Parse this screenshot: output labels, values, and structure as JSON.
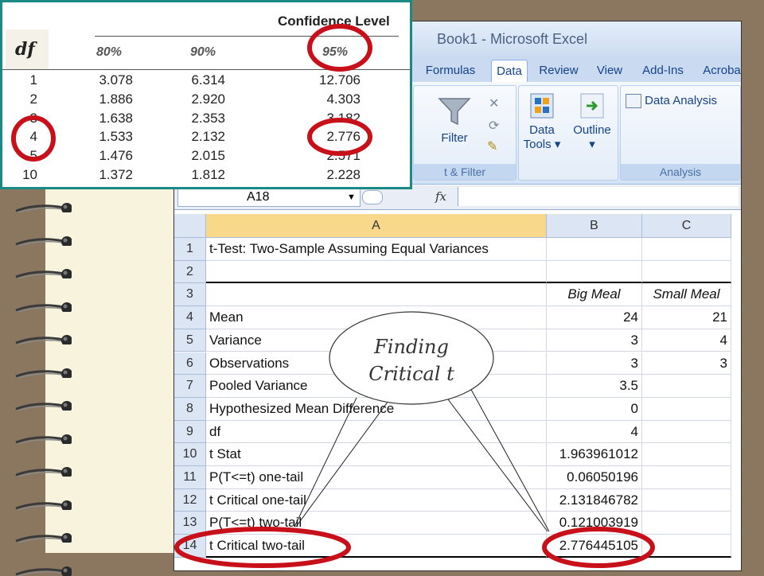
{
  "excel": {
    "title": "Book1 - Microsoft Excel",
    "tabs": [
      "Formulas",
      "Data",
      "Review",
      "View",
      "Add-Ins",
      "Acroba"
    ],
    "active_tab": "Data",
    "ribbon": {
      "filter": "Filter",
      "sort_filter_group": "t & Filter",
      "data_tools_1": "Data",
      "data_tools_2": "Tools",
      "outline": "Outline",
      "data_analysis": "Data Analysis",
      "analysis_group": "Analysis"
    },
    "name_box": "A18",
    "fx": "fx",
    "columns": [
      "A",
      "B",
      "C"
    ],
    "rows": [
      {
        "n": "1",
        "a": "t-Test: Two-Sample Assuming Equal Variances",
        "b": "",
        "c": ""
      },
      {
        "n": "2",
        "a": "",
        "b": "",
        "c": ""
      },
      {
        "n": "3",
        "a": "",
        "b": "Big Meal",
        "c": "Small Meal"
      },
      {
        "n": "4",
        "a": "Mean",
        "b": "24",
        "c": "21"
      },
      {
        "n": "5",
        "a": "Variance",
        "b": "3",
        "c": "4"
      },
      {
        "n": "6",
        "a": "Observations",
        "b": "3",
        "c": "3"
      },
      {
        "n": "7",
        "a": "Pooled Variance",
        "b": "3.5",
        "c": ""
      },
      {
        "n": "8",
        "a": "Hypothesized Mean Difference",
        "b": "0",
        "c": ""
      },
      {
        "n": "9",
        "a": "df",
        "b": "4",
        "c": ""
      },
      {
        "n": "10",
        "a": "t Stat",
        "b": "1.963961012",
        "c": ""
      },
      {
        "n": "11",
        "a": "P(T<=t) one-tail",
        "b": "0.06050196",
        "c": ""
      },
      {
        "n": "12",
        "a": "t Critical one-tail",
        "b": "2.131846782",
        "c": ""
      },
      {
        "n": "13",
        "a": "P(T<=t) two-tail",
        "b": "0.121003919",
        "c": ""
      },
      {
        "n": "14",
        "a": "t Critical two-tail",
        "b": "2.776445105",
        "c": ""
      }
    ]
  },
  "t_table": {
    "heading": "Confidence Level",
    "df_label": "df",
    "levels": [
      "80%",
      "90%",
      "95%"
    ],
    "rows": [
      {
        "df": "1",
        "v80": "3.078",
        "v90": "6.314",
        "v95": "12.706"
      },
      {
        "df": "2",
        "v80": "1.886",
        "v90": "2.920",
        "v95": "4.303"
      },
      {
        "df": "3",
        "v80": "1.638",
        "v90": "2.353",
        "v95": "3.182"
      },
      {
        "df": "4",
        "v80": "1.533",
        "v90": "2.132",
        "v95": "2.776"
      },
      {
        "df": "5",
        "v80": "1.476",
        "v90": "2.015",
        "v95": "2.571"
      },
      {
        "df": "10",
        "v80": "1.372",
        "v90": "1.812",
        "v95": "2.228"
      }
    ]
  },
  "callout": {
    "line1": "Finding",
    "line2": "Critical t"
  },
  "colors": {
    "highlight_circle": "#c8101a",
    "table_border": "#1a8a86",
    "background": "#8b7660"
  }
}
